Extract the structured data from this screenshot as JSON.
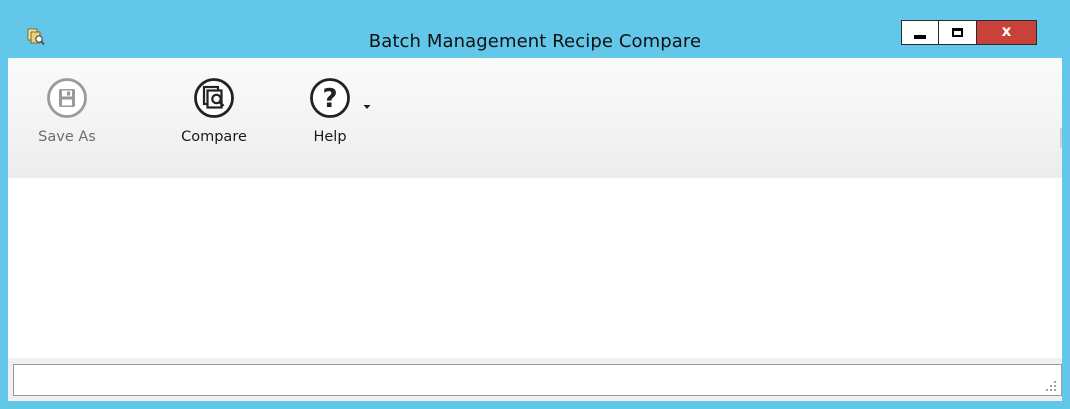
{
  "window": {
    "title": "Batch Management Recipe Compare",
    "app_icon": "recipe-compare-icon",
    "controls": {
      "minimize": "minimize-icon",
      "maximize": "maximize-icon",
      "close_label": "x"
    }
  },
  "ribbon": {
    "buttons": [
      {
        "label": "Save As",
        "icon": "floppy-disk-icon",
        "enabled": false
      },
      {
        "label": "Compare",
        "icon": "compare-documents-icon",
        "enabled": true
      },
      {
        "label": "Help",
        "icon": "question-mark-icon",
        "enabled": true,
        "has_dropdown": true
      }
    ]
  },
  "statusbar": {
    "text": ""
  },
  "colors": {
    "frame": "#63c7ea",
    "close_button": "#c8423a",
    "ribbon_background": "#f3f3f3"
  }
}
